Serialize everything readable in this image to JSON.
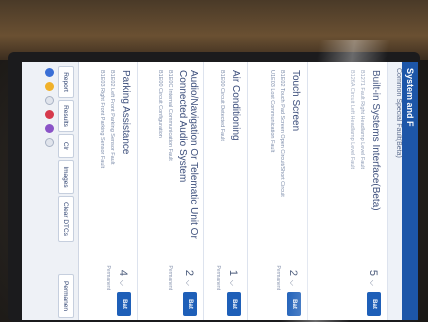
{
  "header": {
    "title": "System and F",
    "subtitle": "Common Special Fault(Beta)"
  },
  "sections": [
    {
      "title": "Built-in Systems Interface(Beta)",
      "count": "5",
      "button": "Bat",
      "details": [
        "B1271 Fault Right Headlamp Level Fault",
        "B126A Circuit Left Headlamp Level Fault"
      ]
    },
    {
      "title": "Touch Screen",
      "count": "2",
      "button": "Bat",
      "perm": "Permanent",
      "details": [
        "B1E02 Touch Pad Screen Open Circuit/Short Circuit",
        "U1E03 Lost Communication Fault"
      ]
    },
    {
      "title": "Air Conditioning",
      "count": "1",
      "button": "Bat",
      "perm": "Permanent",
      "details": [
        "B1E00 Circuit Detected Fault"
      ]
    },
    {
      "title": "Audio/Navigation Or Telematic Unit Or Connected Audio System",
      "count": "2",
      "button": "Bat",
      "perm": "Permanent",
      "details": [
        "B1E0C Internal Communication Fault",
        "B1E00 Circuit Configuration"
      ]
    },
    {
      "title": "Parking Assistance",
      "count": "4",
      "button": "Bat",
      "perm": "Permanent",
      "details": [
        "B1E02 Left Front Parking Sensor Fault",
        "B1E03 Right Front Parking Sensor Fault"
      ]
    }
  ],
  "bottom_bar": {
    "buttons": [
      "Report",
      "Results",
      "Clr",
      "Images",
      "Clear DTCs",
      "Permanen"
    ]
  },
  "colors": {
    "accent": "#1e5fb8",
    "status_bar": "#1d56a8",
    "text": "#34466e"
  }
}
